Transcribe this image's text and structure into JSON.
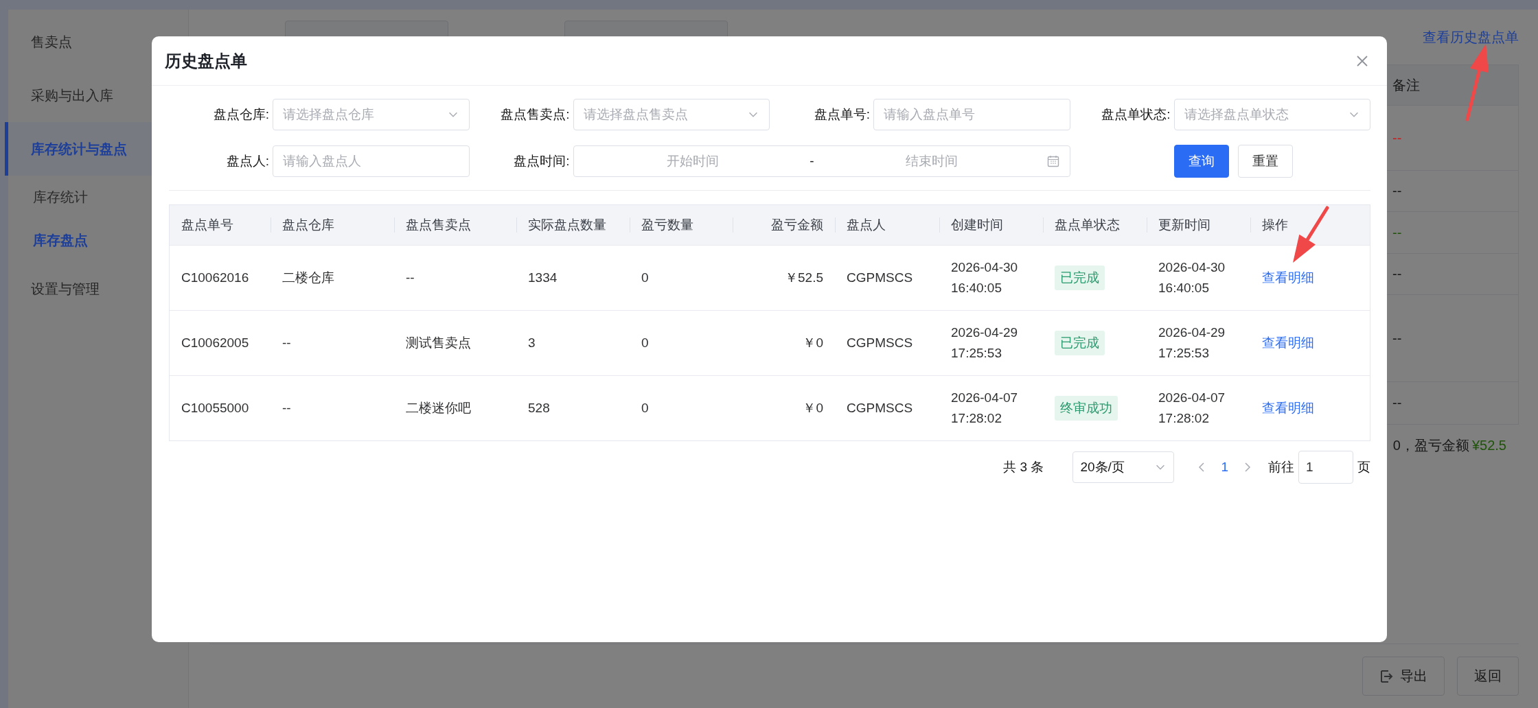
{
  "sidebar": {
    "items": [
      {
        "label": "售卖点",
        "selected": false
      },
      {
        "label": "采购与出入库",
        "selected": false
      },
      {
        "label": "库存统计与盘点",
        "selected": true,
        "children": [
          {
            "label": "库存统计",
            "selected": false
          },
          {
            "label": "库存盘点",
            "selected": true
          }
        ]
      },
      {
        "label": "设置与管理",
        "selected": false
      }
    ]
  },
  "page": {
    "history_link": "查看历史盘点单",
    "table": {
      "columns": [
        "备注"
      ],
      "rows": [
        {
          "note": "--",
          "color": "#c81e1e"
        },
        {
          "note": "--",
          "color": "#181818"
        },
        {
          "note": "--",
          "color": "#1f540a"
        },
        {
          "note": "--",
          "color": "#181818"
        },
        {
          "note": "--",
          "color": "#181818"
        },
        {
          "note": "--",
          "color": "#181818"
        }
      ]
    },
    "summary": {
      "text": "0，盈亏金额",
      "amount": "¥52.5"
    },
    "buttons": [
      {
        "label": "导出",
        "kind": "export"
      },
      {
        "label": "返回",
        "kind": "plain"
      }
    ]
  },
  "dialog": {
    "title": "历史盘点单",
    "filters": [
      {
        "label": "盘点仓库:",
        "kind": "select",
        "placeholder": "请选择盘点仓库"
      },
      {
        "label": "盘点售卖点:",
        "kind": "select",
        "placeholder": "请选择盘点售卖点"
      },
      {
        "label": "盘点单号:",
        "kind": "input",
        "placeholder": "请输入盘点单号"
      },
      {
        "label": "盘点单状态:",
        "kind": "select",
        "placeholder": "请选择盘点单状态"
      },
      {
        "label": "盘点人:",
        "kind": "input",
        "placeholder": "请输入盘点人"
      },
      {
        "label": "盘点时间:",
        "kind": "daterange",
        "start_placeholder": "开始时间",
        "separator": "-",
        "end_placeholder": "结束时间"
      }
    ],
    "buttons": [
      {
        "label": "查询",
        "kind": "primary"
      },
      {
        "label": "重置",
        "kind": "default"
      }
    ],
    "table": {
      "columns": [
        {
          "label": "盘点单号",
          "kind": "text"
        },
        {
          "label": "盘点仓库",
          "kind": "text"
        },
        {
          "label": "盘点售卖点",
          "kind": "text"
        },
        {
          "label": "实际盘点数量",
          "kind": "text"
        },
        {
          "label": "盈亏数量",
          "kind": "text"
        },
        {
          "label": "盈亏金额",
          "kind": "amount"
        },
        {
          "label": "盘点人",
          "kind": "text"
        },
        {
          "label": "创建时间",
          "kind": "text"
        },
        {
          "label": "盘点单状态",
          "kind": "tag"
        },
        {
          "label": "更新时间",
          "kind": "text"
        },
        {
          "label": "操作",
          "kind": "link"
        }
      ],
      "rows": [
        {
          "cells": [
            "C10062016",
            "二楼仓库",
            "--",
            "1334",
            "0",
            "￥52.5",
            "CGPMSCS",
            "2026-04-30 16:40:05",
            "已完成",
            "2026-04-30 16:40:05",
            "查看明细"
          ]
        },
        {
          "cells": [
            "C10062005",
            "--",
            "测试售卖点",
            "3",
            "0",
            "￥0",
            "CGPMSCS",
            "2026-04-29 17:25:53",
            "已完成",
            "2026-04-29 17:25:53",
            "查看明细"
          ]
        },
        {
          "cells": [
            "C10055000",
            "--",
            "二楼迷你吧",
            "528",
            "0",
            "￥0",
            "CGPMSCS",
            "2026-04-07 17:28:02",
            "终审成功",
            "2026-04-07 17:28:02",
            "查看明细"
          ]
        }
      ]
    },
    "pagination": {
      "total": "共 3 条",
      "page_size": "20条/页",
      "pages": [
        {
          "label": "1",
          "selected": true
        }
      ],
      "goto_label": "前往",
      "goto_value": "1",
      "page_suffix": "页"
    }
  }
}
